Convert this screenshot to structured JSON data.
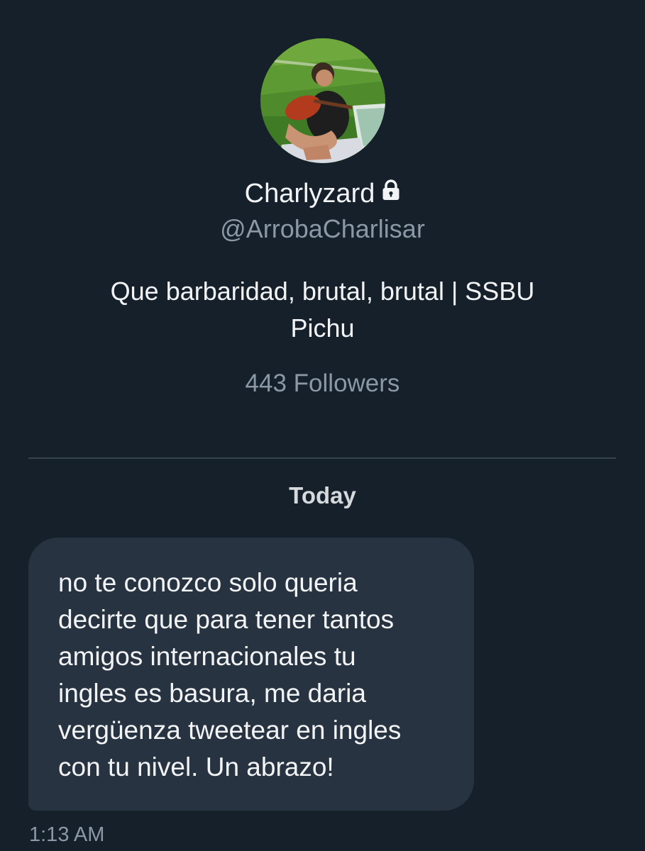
{
  "profile": {
    "avatar_alt": "avatar",
    "name": "Charlyzard",
    "lock_icon": "lock-icon",
    "handle": "@ArrobaCharlisar",
    "bio": "Que barbaridad, brutal, brutal | SSBU\nPichu",
    "followers": "443 Followers"
  },
  "conversation": {
    "day_label": "Today",
    "messages": [
      {
        "text": "no te conozco solo queria\ndecirte que para tener tantos\namigos internacionales tu\ningles es basura, me daria\nvergüenza tweetear en ingles\ncon tu nivel. Un abrazo!",
        "time": "1:13 AM"
      }
    ]
  },
  "colors": {
    "background": "#15202b",
    "bubble": "#273340",
    "secondary_text": "#8b98a5",
    "divider": "#38444d"
  }
}
